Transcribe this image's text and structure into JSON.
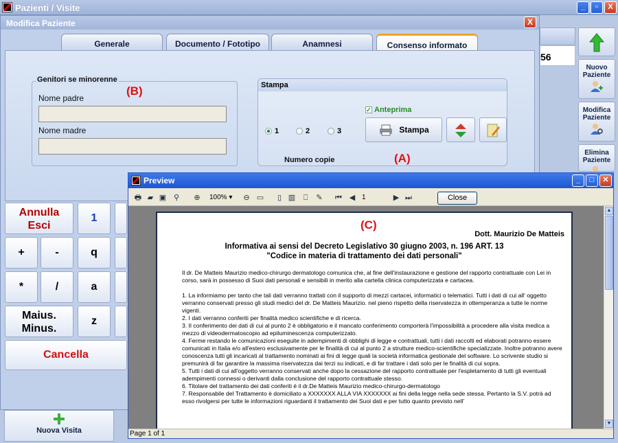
{
  "app": {
    "title": "Pazienti / Visite",
    "buttons": {
      "minimize": "_",
      "maximize": "▫",
      "close": "X"
    }
  },
  "background": {
    "cell_value": "56",
    "sidebar": [
      {
        "label": "Nuovo Paziente",
        "icon": "person-add-icon"
      },
      {
        "label": "Modifica Paziente",
        "icon": "person-search-icon"
      },
      {
        "label": "Elimina Paziente",
        "icon": "person-delete-icon"
      }
    ],
    "nav_button": "Nuova Visita"
  },
  "dialog": {
    "title": "Modifica Paziente",
    "close": "X",
    "tabs": [
      {
        "label": "Generale"
      },
      {
        "label": "Documento / Fototipo"
      },
      {
        "label": "Anamnesi"
      },
      {
        "label": "Consenso informato"
      }
    ],
    "active_tab": "Consenso informato",
    "genitori": {
      "group_label": "Genitori se minorenne",
      "father_label": "Nome padre",
      "father_value": "",
      "mother_label": "Nome madre",
      "mother_value": ""
    },
    "stampa": {
      "header": "Stampa",
      "anteprima_label": "Anteprima",
      "anteprima_checked": true,
      "copies": [
        "1",
        "2",
        "3"
      ],
      "selected_copies": "1",
      "copies_label": "Numero copie",
      "print_button": "Stampa"
    },
    "annotations": {
      "a": "(A)",
      "b": "(B)",
      "c": "(C)"
    }
  },
  "keyboard": {
    "annulla": "Annulla",
    "esci": "Esci",
    "maius": "Maius.",
    "minus": "Minus.",
    "cancella": "Cancella",
    "keys": [
      "1",
      "+",
      "-",
      "q",
      "*",
      "/",
      "a",
      "z"
    ]
  },
  "preview": {
    "title": "Preview",
    "zoom": "100%",
    "page_input": "1",
    "close_button": "Close",
    "status": "Page 1 of 1",
    "document": {
      "author": "Dott. Maurizio De Matteis",
      "title_line1": "Informativa ai sensi del Decreto Legislativo 30 giugno 2003, n. 196 ART. 13",
      "title_line2": "\"Codice in materia di trattamento dei dati personali\"",
      "intro": "Il dr. De Matteis Maurizio medico-chirurgo dermatologo comunica che, al fine dell'instaurazione e gestione del rapporto contrattuale con Lei in corso, sarà in possesso di Suoi dati personali e sensibili in merito alla cartella clinica computerizzata e cartacea.",
      "points": [
        "1. La informiamo per tanto che tali dati verranno trattati con il supporto di mezzi cartacei, informatici o telematici. Tutti i dati di cui all' oggetto verranno conservati presso gli studi medici del dr. De Matteis Maurizio. nel pieno rispetto della riservatezza in ottemperanza a tutte le norme vigenti.",
        "2. I dati verranno conferiti per finalità medico scientifiche e di ricerca.",
        "3. Il conferimento dei dati di cui al punto 2 è obbligatorio e il mancato conferimento comporterà l'impossibilità a procedere alla visita medica a mezzo di videodermatoscopio ad epiluminescenza computerizzato.",
        "4. Ferme restando le comunicazioni eseguite in adempimenti di obblighi di legge e contrattuali, tutti i dati raccolti ed elaborati potranno essere comunicati in Italia e/o all'estero esclusivamente per le finalità di cui al punto 2 a strutture medico-scientifiche specializzate. Inoltre potranno avere conoscenza tutti gli incaricati al trattamento nominati ai fini di legge quali la società informatica gestionale del software. Lo scrivente studio si premunirà di far garantire la massima riservatezza dai terzi su indicati, e di far trattare i dati solo per le finalità di cui sopra.",
        "5. Tutti i dati di cui all'oggetto verranno conservati anche dopo la cessazione del rapporto contrattuale per l'espletamento di tutti gli eventuali adempimenti connessi o derivanti dalla conclusione del rapporto contrattuale stesso.",
        "6. Titolare del trattamento dei dati conferiti è il dr.De Matteis Maurizio medico-chirurgo-dermatologo",
        "7. Responsabile del Trattamento è domiciliato a XXXXXXX ALLA VIA XXXXXXX ai fini della legge nella sede stessa. Pertanto la S.V. potrà ad esso rivolgersi per tutte le informazioni riguardanti il trattamento dei Suoi dati e per tutto quanto previsto nell'"
      ]
    }
  }
}
